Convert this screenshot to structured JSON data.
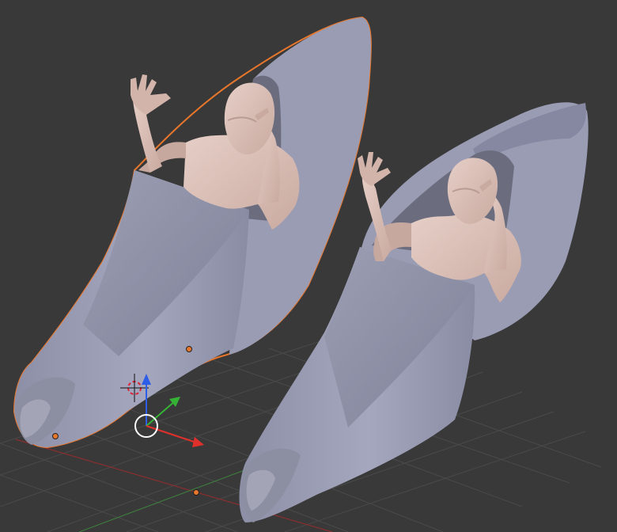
{
  "viewport": {
    "name": "3D Viewport",
    "background": "#393939",
    "grid_color": "#4a4a4a",
    "x_axis_color": "#8a2e2e",
    "y_axis_color": "#3d7a3d",
    "selection_outline_color": "#e8762b"
  },
  "objects": [
    {
      "id": "pod-left",
      "selected": true,
      "body_color": "#9a9cb4",
      "shadow_color": "#6f7186"
    },
    {
      "id": "pod-right",
      "selected": false,
      "body_color": "#9a9cb4",
      "shadow_color": "#6f7186"
    }
  ],
  "figures": [
    {
      "id": "figure-left",
      "skin_color": "#d8bdb4"
    },
    {
      "id": "figure-right",
      "skin_color": "#d8bdb4"
    }
  ],
  "gizmo": {
    "icon": "transform-gizmo-icon",
    "x_color": "#e0302b",
    "y_color": "#35b335",
    "z_color": "#2e5ee8"
  },
  "cursor": {
    "icon": "3d-cursor-icon"
  },
  "origin_points": {
    "color": "#e8762b",
    "count": 3
  }
}
